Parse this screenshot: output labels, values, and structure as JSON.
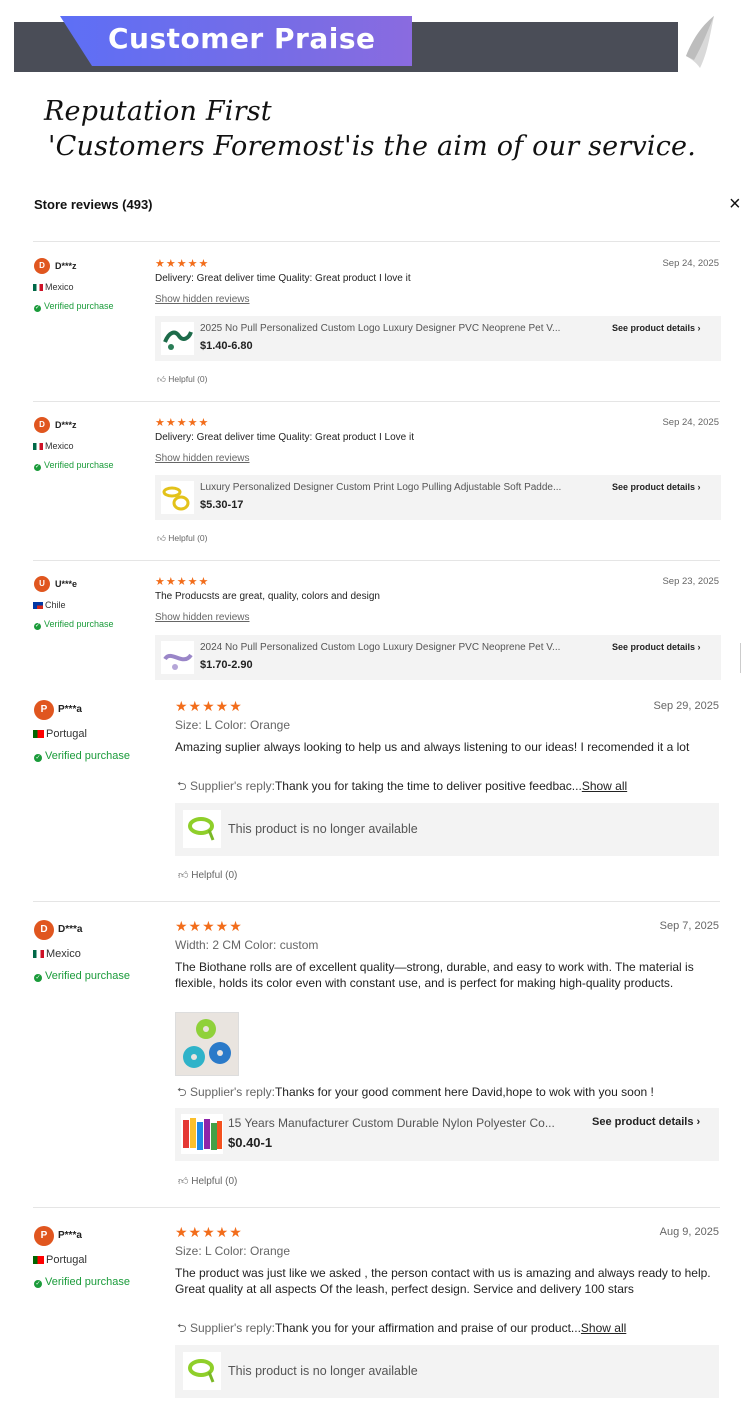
{
  "banner": {
    "title": "Customer Praise"
  },
  "tagline": {
    "line1": "Reputation First",
    "line2": "'Customers Foremost'is the aim of our service."
  },
  "store": {
    "title": "Store reviews (493)",
    "close": "×"
  },
  "colors": {
    "accent": "#f26d1b",
    "verified": "#1a9b3a",
    "avatar": "#e0561f",
    "banner": "#4a4d57"
  },
  "reviews": [
    {
      "avatar": "D",
      "user": "D***z",
      "country": "Mexico",
      "verified": "Verified purchase",
      "stars": "★★★★★",
      "rating": 5,
      "date": "Sep 24, 2025",
      "text": "Delivery:  Great deliver time Quality:  Great product I love it",
      "hidden_link": "Show hidden reviews",
      "product": {
        "title": "2025 No Pull Personalized Custom Logo Luxury Designer PVC Neoprene Pet V...",
        "price": "$1.40-6.80",
        "details": "See product details ›"
      },
      "helpful": "Helpful (0)"
    },
    {
      "avatar": "D",
      "user": "D***z",
      "country": "Mexico",
      "verified": "Verified purchase",
      "stars": "★★★★★",
      "rating": 5,
      "date": "Sep 24, 2025",
      "text": "Delivery:  Great deliver time Quality:  Great product I Love it",
      "hidden_link": "Show hidden reviews",
      "product": {
        "title": "Luxury Personalized Designer Custom Print Logo Pulling Adjustable Soft Padde...",
        "price": "$5.30-17",
        "details": "See product details ›"
      },
      "helpful": "Helpful (0)"
    },
    {
      "avatar": "U",
      "user": "U***e",
      "country": "Chile",
      "verified": "Verified purchase",
      "stars": "★★★★★",
      "rating": 5,
      "date": "Sep 23, 2025",
      "text": "The Producsts are great, quality, colors and design",
      "hidden_link": "Show hidden reviews",
      "product": {
        "title": "2024 No Pull Personalized Custom Logo Luxury Designer PVC Neoprene Pet V...",
        "price": "$1.70-2.90",
        "details": "See product details ›"
      }
    },
    {
      "avatar": "P",
      "user": "P***a",
      "country": "Portugal",
      "verified": "Verified purchase",
      "stars": "★★★★★",
      "rating": 5,
      "date": "Sep 29, 2025",
      "size_label": "Size:",
      "size": "L",
      "color_label": "Color:",
      "color": "Orange",
      "text": "Amazing suplier always looking to help us and always listening to our ideas! I recomended it a lot",
      "reply_label": "Supplier's reply:",
      "reply": "Thank you for taking the time to deliver positive feedbac...",
      "show_all": "Show all",
      "unavailable": "This product is no longer available",
      "helpful": "Helpful (0)"
    },
    {
      "avatar": "D",
      "user": "D***a",
      "country": "Mexico",
      "verified": "Verified purchase",
      "stars": "★★★★★",
      "rating": 5,
      "date": "Sep 7, 2025",
      "size_label": "Width:",
      "size": "2 CM",
      "color_label": "Color:",
      "color": "custom",
      "text": "The Biothane rolls are of excellent quality—strong, durable, and easy to work with. The material is flexible, holds its color even with constant use, and is perfect for making high-quality products.",
      "reply_label": "Supplier's reply:",
      "reply": "Thanks for your good comment here David,hope to wok with you soon !",
      "product": {
        "title": "15 Years Manufacturer Custom Durable Nylon Polyester Co...",
        "price": "$0.40-1",
        "details": "See product details ›"
      },
      "helpful": "Helpful (0)"
    },
    {
      "avatar": "P",
      "user": "P***a",
      "country": "Portugal",
      "verified": "Verified purchase",
      "stars": "★★★★★",
      "rating": 5,
      "date": "Aug 9, 2025",
      "size_label": "Size:",
      "size": "L",
      "color_label": "Color:",
      "color": "Orange",
      "text": "The product was just like we asked , the person contact with us is amazing and always ready to help. Great quality at all aspects Of the leash, perfect design. Service and delivery 100 stars",
      "reply_label": "Supplier's reply:",
      "reply": "Thank you for your affirmation and praise of our product...",
      "show_all": "Show all",
      "unavailable": "This product is no longer available"
    }
  ]
}
